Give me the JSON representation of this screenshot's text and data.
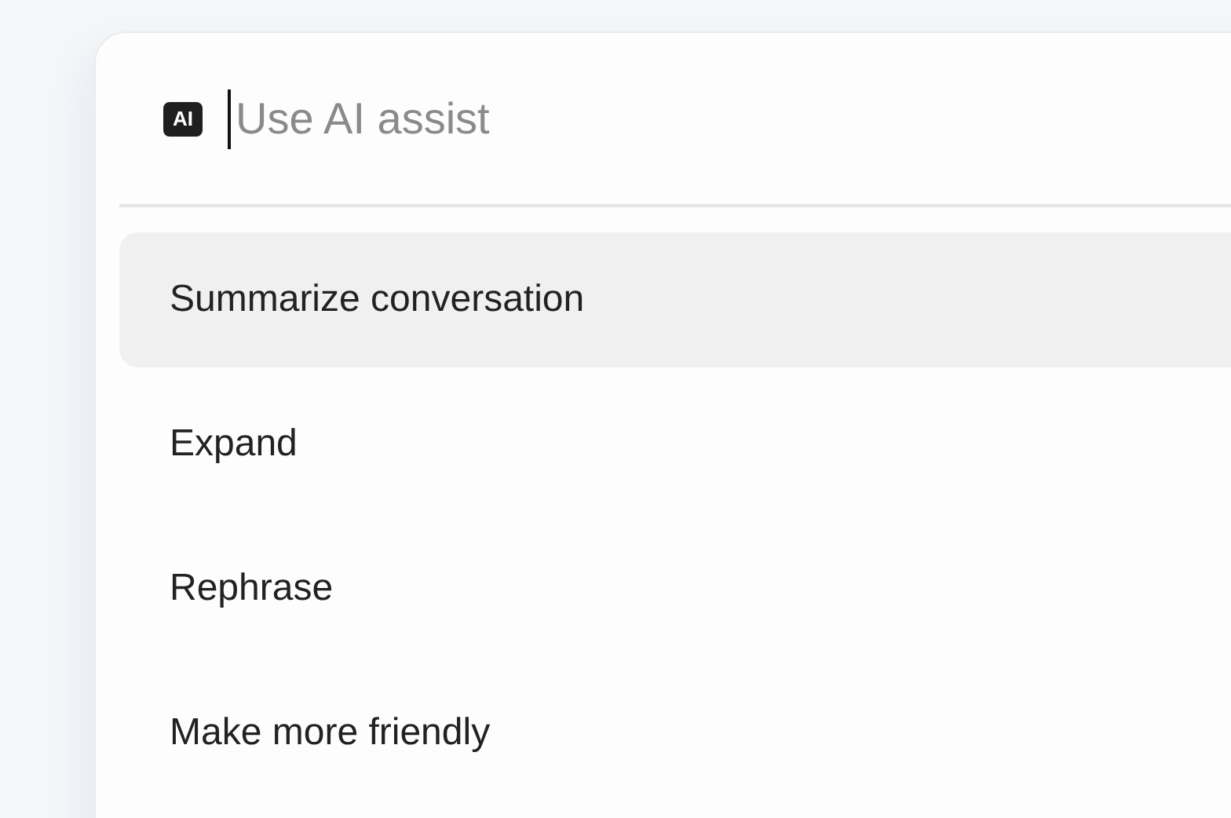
{
  "search": {
    "badge": "AI",
    "placeholder": "Use AI assist"
  },
  "items": [
    {
      "label": "Summarize conversation",
      "selected": true
    },
    {
      "label": "Expand",
      "selected": false
    },
    {
      "label": "Rephrase",
      "selected": false
    },
    {
      "label": "Make more friendly",
      "selected": false
    }
  ]
}
